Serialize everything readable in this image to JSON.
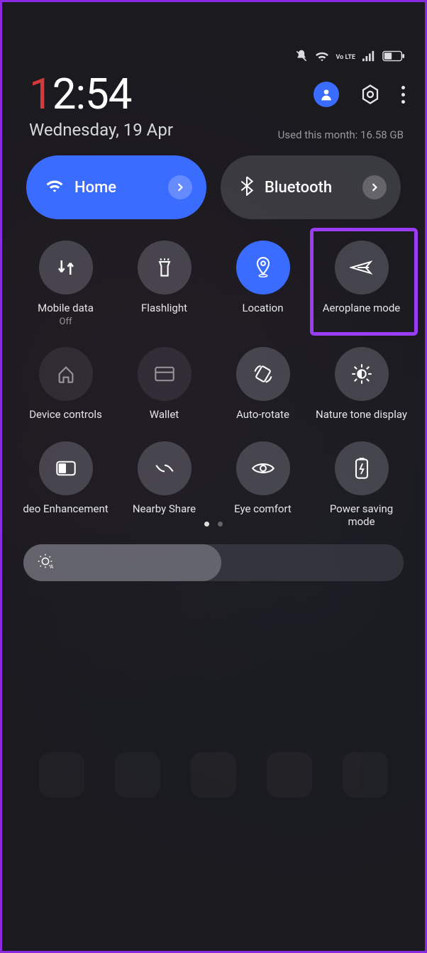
{
  "status": {
    "volte": "Vo LTE"
  },
  "clock": {
    "hour_first": "1",
    "rest": "2:54",
    "date": "Wednesday, 19 Apr"
  },
  "usage_text": "Used this month: 16.58 GB",
  "pills": {
    "wifi": {
      "label": "Home"
    },
    "bluetooth": {
      "label": "Bluetooth"
    }
  },
  "tiles": [
    {
      "id": "mobile-data",
      "label": "Mobile data",
      "sub": "Off",
      "state": "off"
    },
    {
      "id": "flashlight",
      "label": "Flashlight",
      "state": "off"
    },
    {
      "id": "location",
      "label": "Location",
      "state": "on"
    },
    {
      "id": "aeroplane",
      "label": "Aeroplane mode",
      "state": "off",
      "highlighted": true
    },
    {
      "id": "device-controls",
      "label": "Device controls",
      "state": "disabled"
    },
    {
      "id": "wallet",
      "label": "Wallet",
      "state": "disabled"
    },
    {
      "id": "auto-rotate",
      "label": "Auto-rotate",
      "state": "off"
    },
    {
      "id": "nature-tone",
      "label": "Nature tone display",
      "state": "off"
    },
    {
      "id": "video-enh",
      "label": "deo Enhancement",
      "state": "off"
    },
    {
      "id": "nearby-share",
      "label": "Nearby Share",
      "state": "off"
    },
    {
      "id": "eye-comfort",
      "label": "Eye comfort",
      "state": "off"
    },
    {
      "id": "power-saving",
      "label": "Power saving mode",
      "state": "off"
    }
  ],
  "colors": {
    "accent": "#3a6cff",
    "highlight": "#9a3df5"
  }
}
